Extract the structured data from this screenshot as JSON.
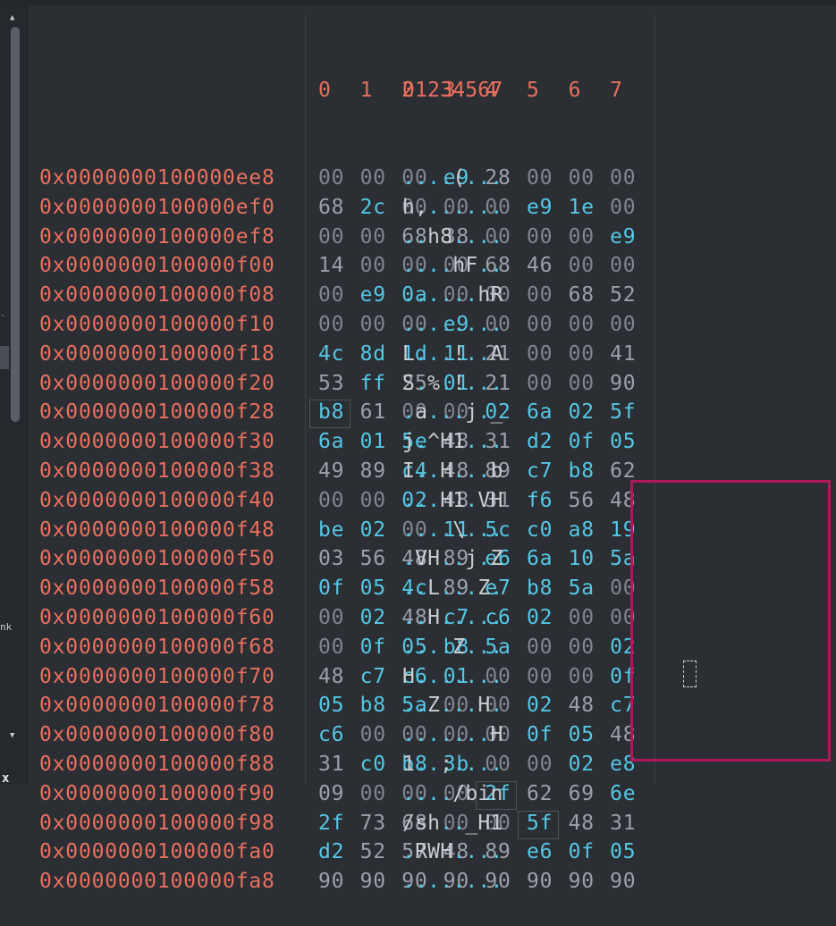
{
  "header": {
    "columns": [
      "0",
      "1",
      "2",
      "3",
      "4",
      "5",
      "6",
      "7"
    ],
    "ascii_header": "01234567"
  },
  "rows": [
    {
      "address": "0x0000000100000ee8",
      "bytes": [
        "00",
        "00",
        "00",
        "e9",
        "28",
        "00",
        "00",
        "00"
      ],
      "ascii": "....(..."
    },
    {
      "address": "0x0000000100000ef0",
      "bytes": [
        "68",
        "2c",
        "00",
        "00",
        "00",
        "e9",
        "1e",
        "00"
      ],
      "ascii": "h,......"
    },
    {
      "address": "0x0000000100000ef8",
      "bytes": [
        "00",
        "00",
        "68",
        "38",
        "00",
        "00",
        "00",
        "e9"
      ],
      "ascii": "..h8...."
    },
    {
      "address": "0x0000000100000f00",
      "bytes": [
        "14",
        "00",
        "00",
        "00",
        "68",
        "46",
        "00",
        "00"
      ],
      "ascii": "....hF.."
    },
    {
      "address": "0x0000000100000f08",
      "bytes": [
        "00",
        "e9",
        "0a",
        "00",
        "00",
        "00",
        "68",
        "52"
      ],
      "ascii": "......hR"
    },
    {
      "address": "0x0000000100000f10",
      "bytes": [
        "00",
        "00",
        "00",
        "e9",
        "00",
        "00",
        "00",
        "00"
      ],
      "ascii": "........"
    },
    {
      "address": "0x0000000100000f18",
      "bytes": [
        "4c",
        "8d",
        "1d",
        "11",
        "21",
        "00",
        "00",
        "41"
      ],
      "ascii": "L...!..A"
    },
    {
      "address": "0x0000000100000f20",
      "bytes": [
        "53",
        "ff",
        "25",
        "01",
        "21",
        "00",
        "00",
        "90"
      ],
      "ascii": "S.%.!..."
    },
    {
      "address": "0x0000000100000f28",
      "bytes": [
        "b8",
        "61",
        "00",
        "00",
        "02",
        "6a",
        "02",
        "5f"
      ],
      "ascii": ".a...j._"
    },
    {
      "address": "0x0000000100000f30",
      "bytes": [
        "6a",
        "01",
        "5e",
        "48",
        "31",
        "d2",
        "0f",
        "05"
      ],
      "ascii": "j.^H1..."
    },
    {
      "address": "0x0000000100000f38",
      "bytes": [
        "49",
        "89",
        "c4",
        "48",
        "89",
        "c7",
        "b8",
        "62"
      ],
      "ascii": "I..H...b"
    },
    {
      "address": "0x0000000100000f40",
      "bytes": [
        "00",
        "00",
        "02",
        "48",
        "31",
        "f6",
        "56",
        "48"
      ],
      "ascii": "...H1.VH"
    },
    {
      "address": "0x0000000100000f48",
      "bytes": [
        "be",
        "02",
        "00",
        "11",
        "5c",
        "c0",
        "a8",
        "19"
      ],
      "ascii": "....\\..."
    },
    {
      "address": "0x0000000100000f50",
      "bytes": [
        "03",
        "56",
        "48",
        "89",
        "e6",
        "6a",
        "10",
        "5a"
      ],
      "ascii": ".VH..j.Z"
    },
    {
      "address": "0x0000000100000f58",
      "bytes": [
        "0f",
        "05",
        "4c",
        "89",
        "e7",
        "b8",
        "5a",
        "00"
      ],
      "ascii": "..L...Z."
    },
    {
      "address": "0x0000000100000f60",
      "bytes": [
        "00",
        "02",
        "48",
        "c7",
        "c6",
        "02",
        "00",
        "00"
      ],
      "ascii": "..H....."
    },
    {
      "address": "0x0000000100000f68",
      "bytes": [
        "00",
        "0f",
        "05",
        "b8",
        "5a",
        "00",
        "00",
        "02"
      ],
      "ascii": "....Z..."
    },
    {
      "address": "0x0000000100000f70",
      "bytes": [
        "48",
        "c7",
        "c6",
        "01",
        "00",
        "00",
        "00",
        "0f"
      ],
      "ascii": "H......."
    },
    {
      "address": "0x0000000100000f78",
      "bytes": [
        "05",
        "b8",
        "5a",
        "00",
        "00",
        "02",
        "48",
        "c7"
      ],
      "ascii": "..Z...H."
    },
    {
      "address": "0x0000000100000f80",
      "bytes": [
        "c6",
        "00",
        "00",
        "00",
        "00",
        "0f",
        "05",
        "48"
      ],
      "ascii": ".......H"
    },
    {
      "address": "0x0000000100000f88",
      "bytes": [
        "31",
        "c0",
        "b8",
        "3b",
        "00",
        "00",
        "02",
        "e8"
      ],
      "ascii": "1..;...."
    },
    {
      "address": "0x0000000100000f90",
      "bytes": [
        "09",
        "00",
        "00",
        "00",
        "2f",
        "62",
        "69",
        "6e"
      ],
      "ascii": "..../bin"
    },
    {
      "address": "0x0000000100000f98",
      "bytes": [
        "2f",
        "73",
        "68",
        "00",
        "00",
        "5f",
        "48",
        "31"
      ],
      "ascii": "/sh.._H1"
    },
    {
      "address": "0x0000000100000fa0",
      "bytes": [
        "d2",
        "52",
        "57",
        "48",
        "89",
        "e6",
        "0f",
        "05"
      ],
      "ascii": ".RWH...."
    },
    {
      "address": "0x0000000100000fa8",
      "bytes": [
        "90",
        "90",
        "90",
        "90",
        "90",
        "90",
        "90",
        "90"
      ],
      "ascii": "........"
    }
  ],
  "side_fragment": "nk",
  "side_close": "x",
  "colors": {
    "background": "#2b2e33",
    "address": "#e8705f",
    "byte_nonzero": "#55c7e5",
    "byte_zero": "#7f8690",
    "highlight_box": "#b0185c"
  },
  "icons": {
    "scroll_up": "triangle-up-icon",
    "scroll_down": "triangle-down-icon"
  }
}
